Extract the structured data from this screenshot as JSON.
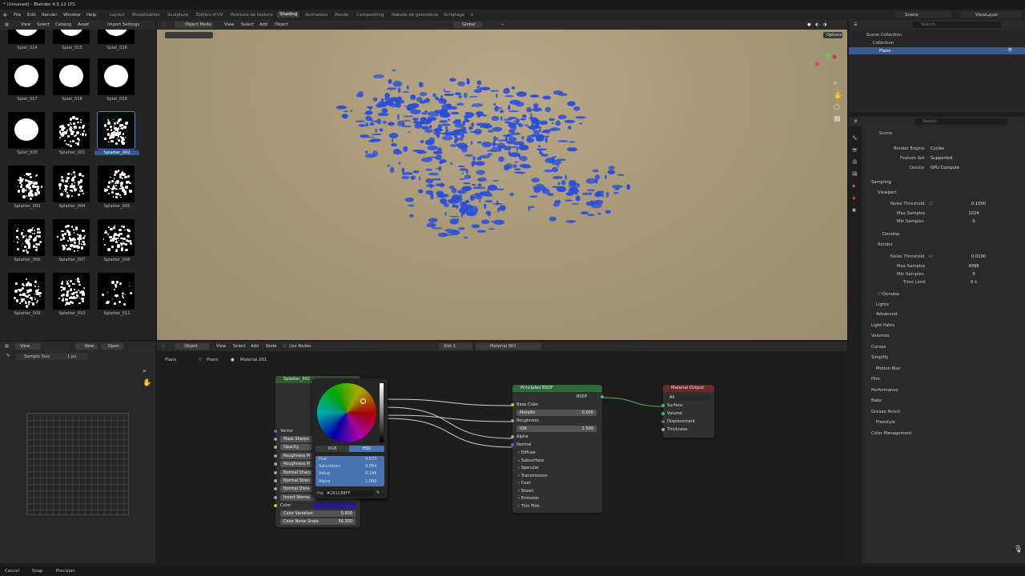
{
  "window": {
    "title": "* (Unsaved) - Blender 4.5.12 LTS"
  },
  "menu": {
    "items": [
      "File",
      "Edit",
      "Render",
      "Window",
      "Help"
    ]
  },
  "workspaces": [
    "Layout",
    "Modélisation",
    "Sculpture",
    "Édition d'UV",
    "Peinture de texture",
    "Shading",
    "Animation",
    "Rendu",
    "Compositing",
    "Nœuds de géométrie",
    "Scriptage"
  ],
  "active_workspace": "Shading",
  "top_right": {
    "scene": "Scene",
    "view_layer": "ViewLayer"
  },
  "asset_browser": {
    "menus": [
      "View",
      "Select",
      "Catalog",
      "Asset"
    ],
    "import_settings": "Import Settings",
    "items": [
      {
        "label": "Splat_014"
      },
      {
        "label": "Splat_015"
      },
      {
        "label": "Splat_016"
      },
      {
        "label": "Splat_017"
      },
      {
        "label": "Splat_018"
      },
      {
        "label": "Splat_019"
      },
      {
        "label": "Splat_020"
      },
      {
        "label": "Splatter_001"
      },
      {
        "label": "Splatter_002"
      },
      {
        "label": "Splatter_003"
      },
      {
        "label": "Splatter_004"
      },
      {
        "label": "Splatter_005"
      },
      {
        "label": "Splatter_006"
      },
      {
        "label": "Splatter_007"
      },
      {
        "label": "Splatter_008"
      },
      {
        "label": "Splatter_009"
      },
      {
        "label": "Splatter_010"
      },
      {
        "label": "Splatter_011"
      }
    ],
    "selected": "Splatter_002"
  },
  "viewport": {
    "mode": "Object Mode",
    "menus": [
      "View",
      "Select",
      "Add",
      "Object"
    ],
    "transform": "Global",
    "options": "Options",
    "paint_color": "#2a4fd8",
    "ground_color": "#a99a7c"
  },
  "outliner": {
    "search_placeholder": "Search",
    "items": [
      {
        "label": "Scene Collection"
      },
      {
        "label": "Collection"
      },
      {
        "label": "Plane"
      }
    ]
  },
  "properties": {
    "search_placeholder": "Search",
    "context": "Scene",
    "render_engine_label": "Render Engine",
    "render_engine": "Cycles",
    "feature_set_label": "Feature Set",
    "feature_set": "Supported",
    "device_label": "Device",
    "device": "GPU Compute",
    "sampling": "Sampling",
    "viewport": "Viewport",
    "noise_threshold_label": "Noise Threshold",
    "vp_noise_threshold": "0.1000",
    "max_samples_label": "Max Samples",
    "vp_max_samples": "1024",
    "min_samples_label": "Min Samples",
    "vp_min_samples": "0",
    "denoise": "Denoise",
    "render": "Render",
    "r_noise_threshold": "0.0100",
    "r_max_samples": "4096",
    "r_min_samples": "0",
    "time_limit_label": "Time Limit",
    "r_time_limit": "0 s",
    "denoise2": "Denoise",
    "lights": "Lights",
    "advanced": "Advanced",
    "sections": [
      "Light Paths",
      "Volumes",
      "Curves",
      "Simplify",
      "Motion Blur",
      "Film",
      "Performance",
      "Bake",
      "Grease Pencil",
      "Freestyle",
      "Color Management"
    ]
  },
  "image_editor": {
    "view": "View",
    "new": "New",
    "open": "Open",
    "sample_size_label": "Sample Size",
    "sample_size": "1 px"
  },
  "node_editor": {
    "object": "Object",
    "menus": [
      "View",
      "Select",
      "Add",
      "Node"
    ],
    "use_nodes": "Use Nodes",
    "slot": "Slot 1",
    "material": "Material.001",
    "breadcrumb": [
      "Plane",
      "Plane",
      "Material.001"
    ]
  },
  "splatter_node": {
    "title": "Splatter_002",
    "vector": "Vector",
    "rows": [
      "Mask Sharpn",
      "Opacity",
      "Roughness M",
      "Roughness M",
      "Normal Sharp",
      "Normal Stren",
      "Normal Dista",
      "Invert Norma"
    ],
    "color": "Color",
    "color_variation_label": "Color Variation",
    "color_variation": "0.800",
    "color_noise_label": "Color Noise Scale",
    "color_noise": "56.300",
    "swatch": "#281C88"
  },
  "color_picker": {
    "tab_rgb": "RGB",
    "tab_hsv": "HSV",
    "hue_label": "Hue",
    "hue": "0.673",
    "sat_label": "Saturation",
    "sat": "0.954",
    "val_label": "Value",
    "val": "0.246",
    "alpha_label": "Alpha",
    "alpha": "1.000",
    "hex_label": "Hex",
    "hex": "#281C88FF"
  },
  "bsdf_node": {
    "title": "Principled BSDF",
    "output": "BSDF",
    "base_color": "Base Color",
    "metallic_label": "Metallic",
    "metallic": "0.000",
    "roughness": "Roughness",
    "ior_label": "IOR",
    "ior": "1.500",
    "alpha": "Alpha",
    "normal": "Normal",
    "panels": [
      "Diffuse",
      "Subsurface",
      "Specular",
      "Transmission",
      "Coat",
      "Sheen",
      "Emission",
      "Thin Film"
    ]
  },
  "output_node": {
    "title": "Material Output",
    "target": "All",
    "inputs": [
      "Surface",
      "Volume",
      "Displacement",
      "Thickness"
    ]
  },
  "statusbar": {
    "cancel": "Cancel",
    "snap": "Snap",
    "precision": "Precision"
  }
}
